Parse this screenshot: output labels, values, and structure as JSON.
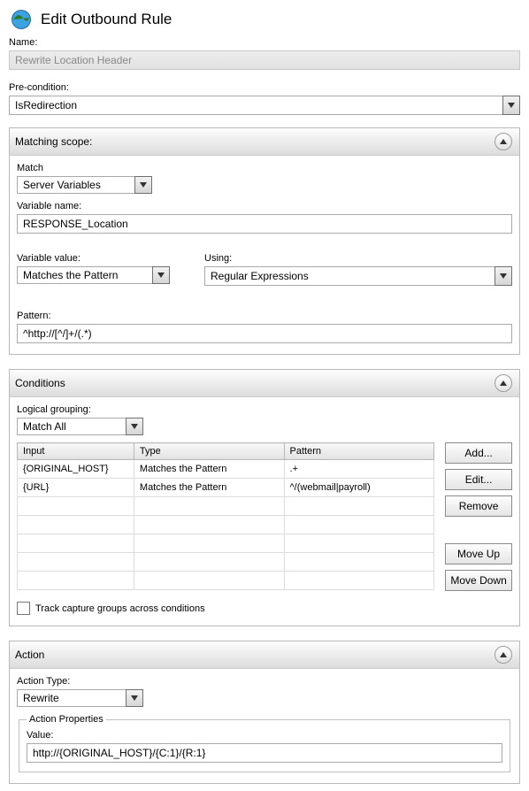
{
  "header": {
    "title": "Edit Outbound Rule"
  },
  "name": {
    "label": "Name:",
    "value": "Rewrite Location Header"
  },
  "precondition": {
    "label": "Pre-condition:",
    "value": "IsRedirection"
  },
  "matching": {
    "title": "Matching scope:",
    "match_label": "Match",
    "match_value": "Server Variables",
    "varname_label": "Variable name:",
    "varname_value": "RESPONSE_Location",
    "varvalue_label": "Variable value:",
    "varvalue_value": "Matches the Pattern",
    "using_label": "Using:",
    "using_value": "Regular Expressions",
    "pattern_label": "Pattern:",
    "pattern_value": "^http://[^/]+/(.*)"
  },
  "conditions": {
    "title": "Conditions",
    "grouping_label": "Logical grouping:",
    "grouping_value": "Match All",
    "headers": {
      "input": "Input",
      "type": "Type",
      "pattern": "Pattern"
    },
    "rows": [
      {
        "input": "{ORIGINAL_HOST}",
        "type": "Matches the Pattern",
        "pattern": ".+"
      },
      {
        "input": "{URL}",
        "type": "Matches the Pattern",
        "pattern": "^/(webmail|payroll)"
      }
    ],
    "buttons": {
      "add": "Add...",
      "edit": "Edit...",
      "remove": "Remove",
      "moveup": "Move Up",
      "movedown": "Move Down"
    },
    "track_label": "Track capture groups across conditions"
  },
  "action": {
    "title": "Action",
    "type_label": "Action Type:",
    "type_value": "Rewrite",
    "props_legend": "Action Properties",
    "value_label": "Value:",
    "value_value": "http://{ORIGINAL_HOST}/{C:1}/{R:1}"
  }
}
